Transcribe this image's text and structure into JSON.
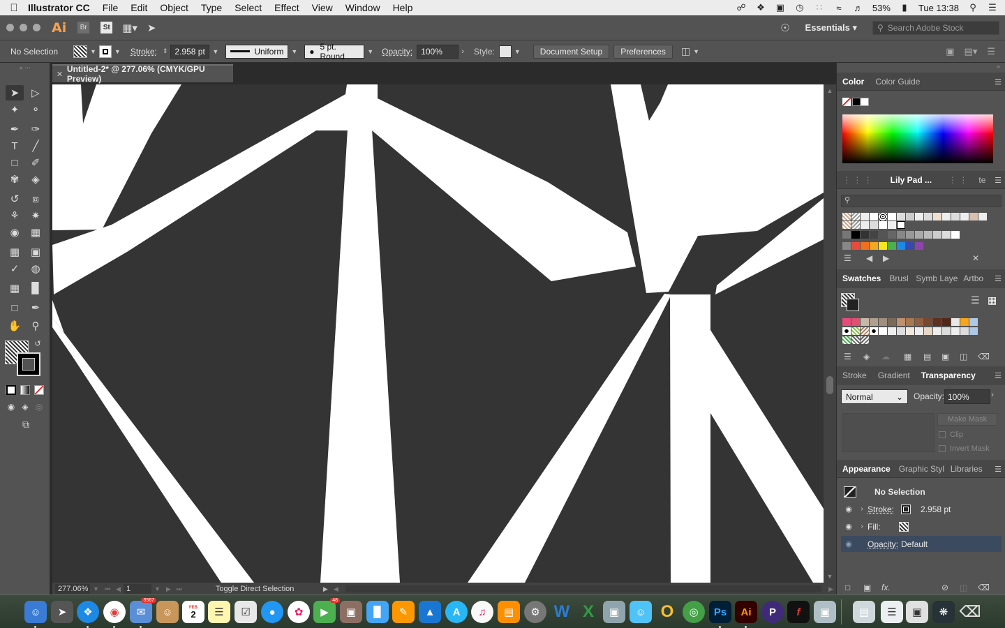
{
  "menubar": {
    "app_name": "Illustrator CC",
    "items": [
      "File",
      "Edit",
      "Object",
      "Type",
      "Select",
      "Effect",
      "View",
      "Window",
      "Help"
    ],
    "battery": "53%",
    "clock": "Tue 13:38"
  },
  "appbar": {
    "ai_logo": "Ai",
    "bridge_label": "Br",
    "stock_label": "St",
    "workspace": "Essentials",
    "stock_search_placeholder": "Search Adobe Stock"
  },
  "control": {
    "selection": "No Selection",
    "stroke_label": "Stroke:",
    "stroke_value": "2.958 pt",
    "profile": "Uniform",
    "brush": "5 pt. Round",
    "opacity_label": "Opacity:",
    "opacity_value": "100%",
    "style_label": "Style:",
    "document_setup": "Document Setup",
    "preferences": "Preferences"
  },
  "document": {
    "tab_title": "Untitled-2* @ 277.06% (CMYK/GPU Preview)"
  },
  "status": {
    "zoom": "277.06%",
    "artboard": "1",
    "message": "Toggle Direct Selection"
  },
  "panels": {
    "color_tabs": [
      "Color",
      "Color Guide"
    ],
    "library_title": "Lily Pad ...",
    "library_short": "te",
    "swatches_tabs": [
      "Swatches",
      "Brusl",
      "Symb",
      "Laye",
      "Artbo"
    ],
    "transparency_tabs": [
      "Stroke",
      "Gradient",
      "Transparency"
    ],
    "blend_mode": "Normal",
    "opacity_label": "Opacity:",
    "opacity_value": "100%",
    "make_mask": "Make Mask",
    "clip": "Clip",
    "invert_mask": "Invert Mask",
    "appearance_tabs": [
      "Appearance",
      "Graphic Styl",
      "Libraries"
    ],
    "appearance": {
      "title": "No Selection",
      "stroke_label": "Stroke:",
      "stroke_value": "2.958 pt",
      "fill_label": "Fill:",
      "opacity_label": "Opacity:",
      "opacity_value": "Default"
    }
  },
  "dock": {
    "mail_badge": "3567",
    "calendar_month": "FEB",
    "calendar_day": "2",
    "messages_badge": "48",
    "ps_label": "Ps",
    "ai_label": "Ai"
  },
  "colors": {
    "canvas_dark": "#343434",
    "artwork_white": "#ffffff",
    "ui_panel": "#535353",
    "ai_orange": "#f7a14b"
  }
}
